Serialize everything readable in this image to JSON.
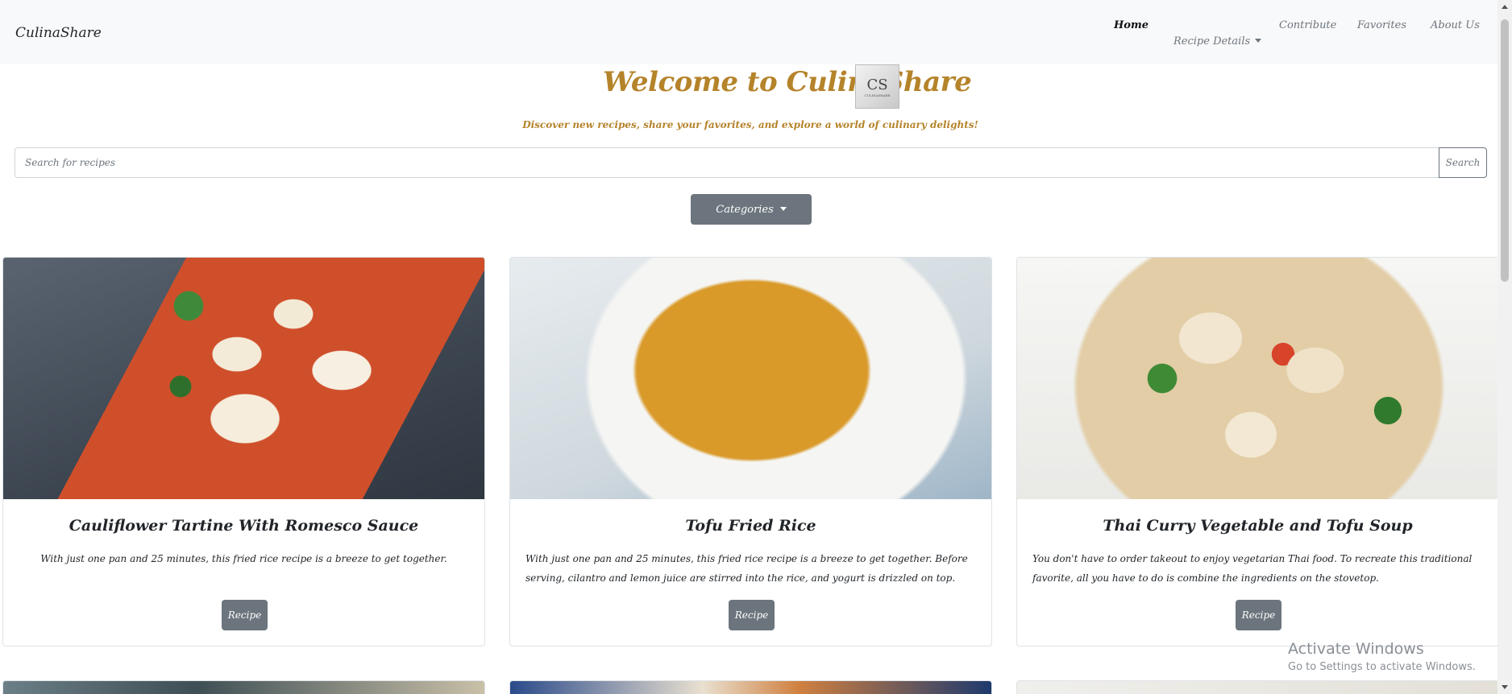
{
  "navbar": {
    "brand": "CulinaShare",
    "links": {
      "home": "Home",
      "recipe_details": "Recipe Details",
      "contribute": "Contribute",
      "favorites": "Favorites",
      "about": "About Us"
    }
  },
  "hero": {
    "title": "Welcome to CulinaShare",
    "logo_monogram": "CS",
    "logo_text": "CULINASHARE",
    "tagline": "Discover new recipes, share your favorites, and explore a world of culinary delights!"
  },
  "search": {
    "placeholder": "Search for recipes",
    "value": "",
    "button_label": "Search"
  },
  "categories": {
    "button_label": "Categories"
  },
  "cards": [
    {
      "title": "Cauliflower Tartine With Romesco Sauce",
      "text": "With just one pan and 25 minutes, this fried rice recipe is a breeze to get together.",
      "button_label": "Recipe"
    },
    {
      "title": "Tofu Fried Rice",
      "text": "With just one pan and 25 minutes, this fried rice recipe is a breeze to get together. Before serving, cilantro and lemon juice are stirred into the rice, and yogurt is drizzled on top.",
      "button_label": "Recipe"
    },
    {
      "title": "Thai Curry Vegetable and Tofu Soup",
      "text": "You don't have to order takeout to enjoy vegetarian Thai food. To recreate this traditional favorite, all you have to do is combine the ingredients on the stovetop.",
      "button_label": "Recipe"
    }
  ],
  "watermark": {
    "line1": "Activate Windows",
    "line2": "Go to Settings to activate Windows."
  },
  "colors": {
    "accent": "#b5832a",
    "button": "#6c757d",
    "navbar_bg": "#f8f9fa"
  }
}
